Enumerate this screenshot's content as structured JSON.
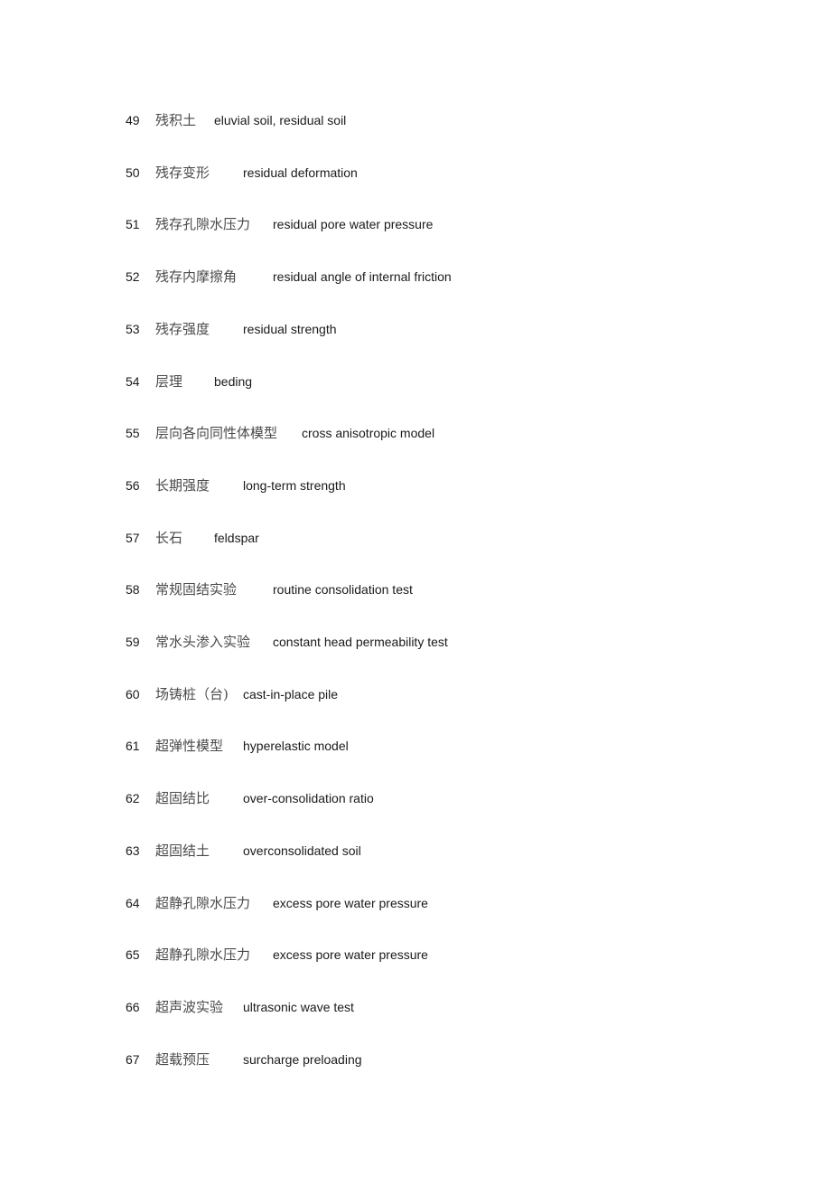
{
  "entries": [
    {
      "num": "49",
      "zh": "残积土",
      "en": "eluvial soil, residual soil",
      "col": 1
    },
    {
      "num": "50",
      "zh": "残存变形",
      "en": "residual deformation",
      "col": 2
    },
    {
      "num": "51",
      "zh": "残存孔隙水压力",
      "en": "residual pore water pressure",
      "col": 3
    },
    {
      "num": "52",
      "zh": "残存内摩擦角",
      "en": "residual angle of internal friction",
      "col": 3
    },
    {
      "num": "53",
      "zh": "残存强度",
      "en": "residual strength",
      "col": 2
    },
    {
      "num": "54",
      "zh": "层理",
      "en": "beding",
      "col": 1
    },
    {
      "num": "55",
      "zh": "层向各向同性体模型",
      "en": "cross anisotropic model",
      "col": 4
    },
    {
      "num": "56",
      "zh": "长期强度",
      "en": "long-term strength",
      "col": 2
    },
    {
      "num": "57",
      "zh": "长石",
      "en": "feldspar",
      "col": 1
    },
    {
      "num": "58",
      "zh": "常规固结实验",
      "en": "routine consolidation test",
      "col": 3
    },
    {
      "num": "59",
      "zh": "常水头渗入实验",
      "en": "constant head permeability test",
      "col": 3
    },
    {
      "num": "60",
      "zh": "场铸桩（台)",
      "en": "cast-in-place pile",
      "col": 2
    },
    {
      "num": "61",
      "zh": "超弹性模型",
      "en": "hyperelastic model",
      "col": 2
    },
    {
      "num": "62",
      "zh": "超固结比",
      "en": "over-consolidation ratio",
      "col": 2
    },
    {
      "num": "63",
      "zh": "超固结土",
      "en": "overconsolidated soil",
      "col": 2
    },
    {
      "num": "64",
      "zh": "超静孔隙水压力",
      "en": "excess pore water pressure",
      "col": 3
    },
    {
      "num": "65",
      "zh": "超静孔隙水压力",
      "en": "excess pore water pressure",
      "col": 3
    },
    {
      "num": "66",
      "zh": "超声波实验",
      "en": "ultrasonic wave test",
      "col": 2
    },
    {
      "num": "67",
      "zh": "超载预压",
      "en": "surcharge preloading",
      "col": 2
    }
  ]
}
